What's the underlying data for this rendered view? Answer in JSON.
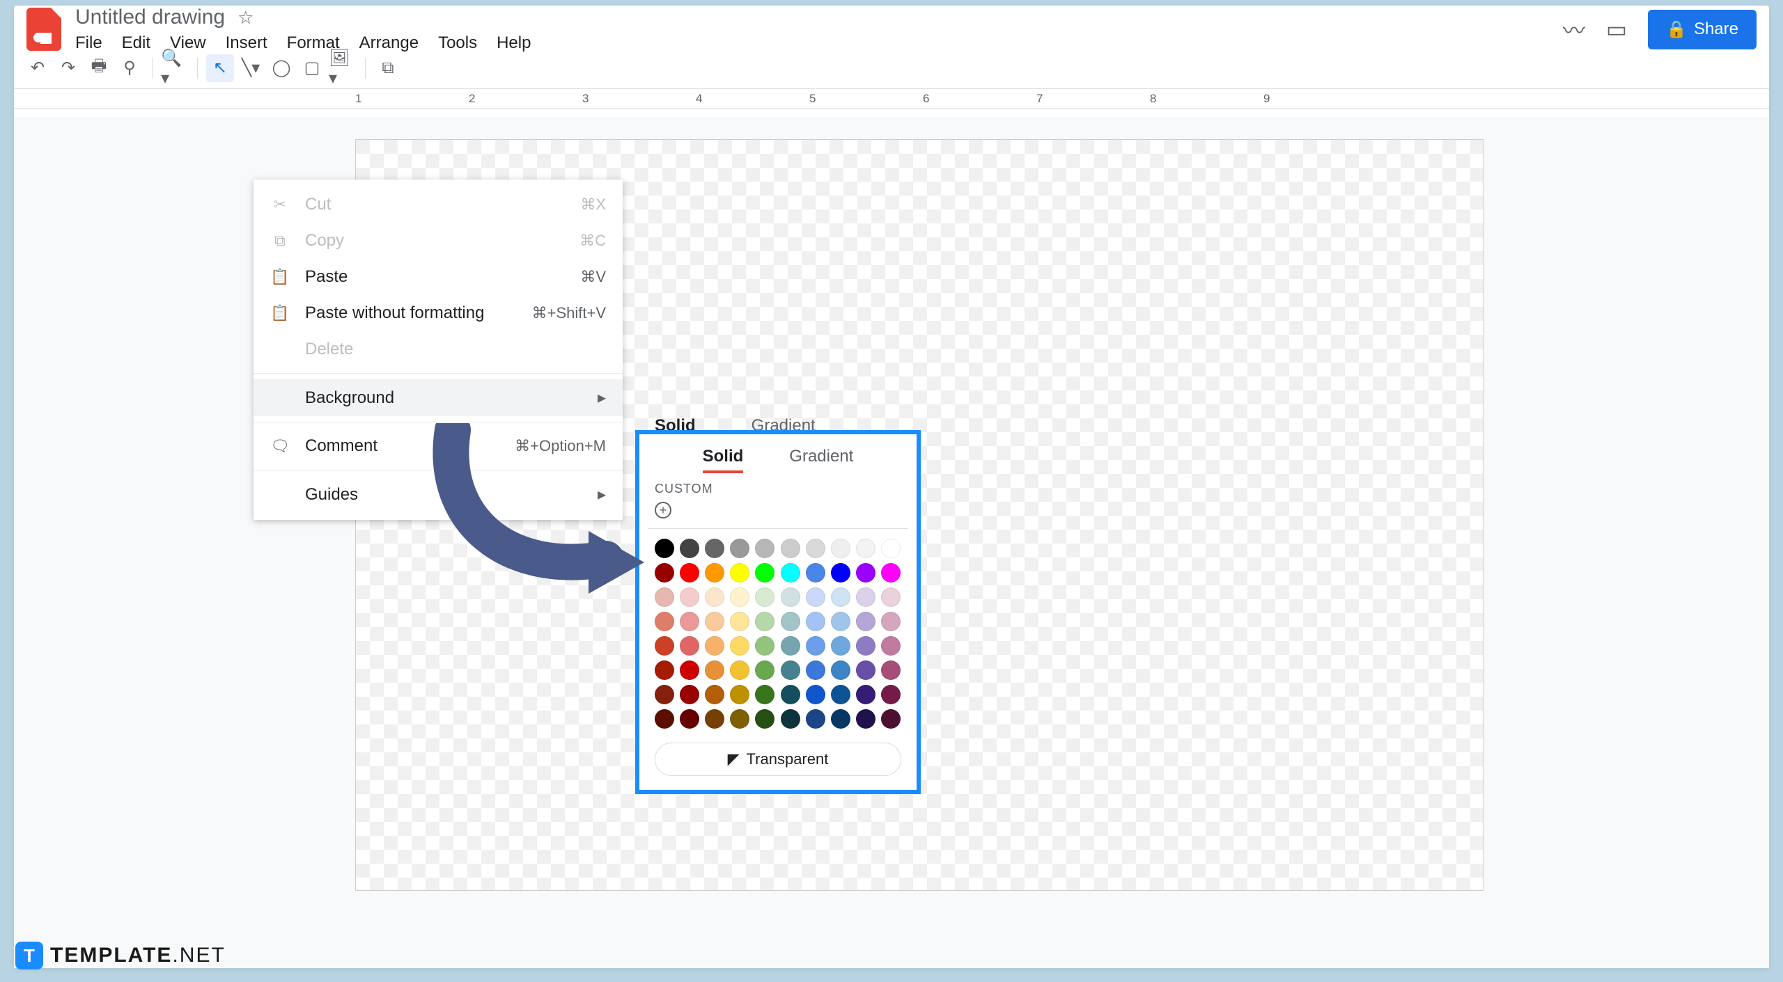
{
  "doc": {
    "title": "Untitled drawing"
  },
  "menubar": [
    "File",
    "Edit",
    "View",
    "Insert",
    "Format",
    "Arrange",
    "Tools",
    "Help"
  ],
  "share_label": "Share",
  "ruler_numbers": [
    1,
    2,
    3,
    4,
    5,
    6,
    7,
    8,
    9
  ],
  "context_menu": {
    "cut": {
      "label": "Cut",
      "shortcut": "⌘X"
    },
    "copy": {
      "label": "Copy",
      "shortcut": "⌘C"
    },
    "paste": {
      "label": "Paste",
      "shortcut": "⌘V"
    },
    "paste_without": {
      "label": "Paste without formatting",
      "shortcut": "⌘+Shift+V"
    },
    "delete": {
      "label": "Delete"
    },
    "background": {
      "label": "Background"
    },
    "comment": {
      "label": "Comment",
      "shortcut": "⌘+Option+M"
    },
    "guides": {
      "label": "Guides"
    }
  },
  "submenu_bare": {
    "solid": "Solid",
    "gradient": "Gradient"
  },
  "color_picker": {
    "tab_solid": "Solid",
    "tab_gradient": "Gradient",
    "custom_label": "CUSTOM",
    "transparent_label": "Transparent",
    "palette": [
      [
        "#000000",
        "#434343",
        "#666666",
        "#999999",
        "#b7b7b7",
        "#cccccc",
        "#d9d9d9",
        "#efefef",
        "#f3f3f3",
        "#ffffff"
      ],
      [
        "#980000",
        "#ff0000",
        "#ff9900",
        "#ffff00",
        "#00ff00",
        "#00ffff",
        "#4a86e8",
        "#0000ff",
        "#9900ff",
        "#ff00ff"
      ],
      [
        "#e6b8af",
        "#f4cccc",
        "#fce5cd",
        "#fff2cc",
        "#d9ead3",
        "#d0e0e3",
        "#c9daf8",
        "#cfe2f3",
        "#d9d2e9",
        "#ead1dc"
      ],
      [
        "#dd7e6b",
        "#ea9999",
        "#f9cb9c",
        "#ffe599",
        "#b6d7a8",
        "#a2c4c9",
        "#a4c2f4",
        "#9fc5e8",
        "#b4a7d6",
        "#d5a6bd"
      ],
      [
        "#cc4125",
        "#e06666",
        "#f6b26b",
        "#ffd966",
        "#93c47d",
        "#76a5af",
        "#6d9eeb",
        "#6fa8dc",
        "#8e7cc3",
        "#c27ba0"
      ],
      [
        "#a61c00",
        "#cc0000",
        "#e69138",
        "#f1c232",
        "#6aa84f",
        "#45818e",
        "#3c78d8",
        "#3d85c6",
        "#674ea7",
        "#a64d79"
      ],
      [
        "#85200c",
        "#990000",
        "#b45f06",
        "#bf9000",
        "#38761d",
        "#134f5c",
        "#1155cc",
        "#0b5394",
        "#351c75",
        "#741b47"
      ],
      [
        "#5b0f00",
        "#660000",
        "#783f04",
        "#7f6000",
        "#274e13",
        "#0c343d",
        "#1c4587",
        "#073763",
        "#20124d",
        "#4c1130"
      ]
    ]
  },
  "watermark": {
    "bold": "TEMPLATE",
    "net": ".NET"
  }
}
